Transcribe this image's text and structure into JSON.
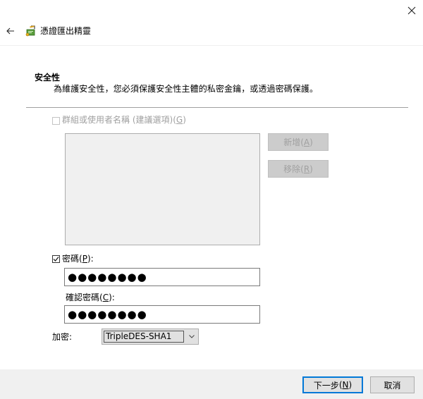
{
  "window": {
    "title": "憑證匯出精靈"
  },
  "section": {
    "title": "安全性",
    "description": "為維護安全性，您必須保護安全性主體的私密金鑰，或透過密碼保護。"
  },
  "group_option": {
    "label": "群組或使用者名稱 (建議選項)",
    "mnemonic": "G",
    "checked": false,
    "enabled": false
  },
  "buttons": {
    "add_label": "新增",
    "add_mnemonic": "A",
    "remove_label": "移除",
    "remove_mnemonic": "R",
    "next_label": "下一步",
    "next_mnemonic": "N",
    "cancel_label": "取消"
  },
  "password": {
    "label": "密碼",
    "mnemonic": "P",
    "checked": true,
    "value": "●●●●●●●●",
    "confirm_label": "確認密碼",
    "confirm_mnemonic": "C",
    "confirm_value": "●●●●●●●●"
  },
  "encryption": {
    "label": "加密:",
    "selected": "TripleDES-SHA1"
  },
  "icons": {
    "back": "back-arrow-icon",
    "close": "close-icon",
    "wizard": "certificate-wizard-icon",
    "dropdown": "chevron-down-icon",
    "check": "checkmark-icon"
  },
  "colors": {
    "accent": "#0078d7",
    "footer_bg": "#f0f0f0",
    "disabled_text": "#a0a0a0"
  }
}
